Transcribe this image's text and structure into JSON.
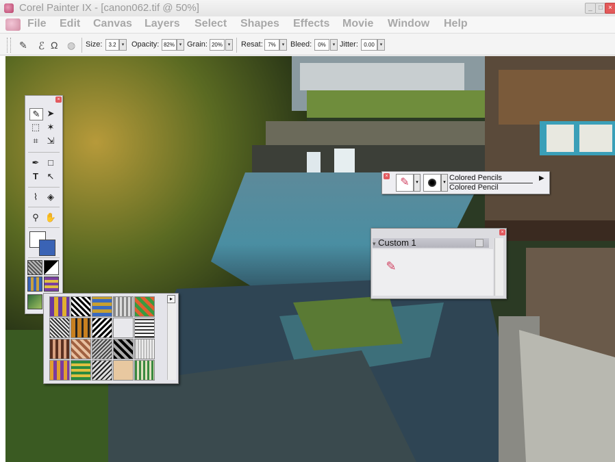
{
  "window": {
    "title": "Corel Painter IX - [canon062.tif @ 50%]"
  },
  "menu": [
    "File",
    "Edit",
    "Canvas",
    "Layers",
    "Select",
    "Shapes",
    "Effects",
    "Movie",
    "Window",
    "Help"
  ],
  "property_bar": {
    "size_label": "Size:",
    "size_value": "3.2",
    "opacity_label": "Opacity:",
    "opacity_value": "82%",
    "grain_label": "Grain:",
    "grain_value": "20%",
    "resat_label": "Resat:",
    "resat_value": "7%",
    "bleed_label": "Bleed:",
    "bleed_value": "0%",
    "jitter_label": "Jitter:",
    "jitter_value": "0.00"
  },
  "brush_selector": {
    "category": "Colored Pencils",
    "variant": "Colored Pencil"
  },
  "custom_palette": {
    "title": "Custom 1"
  },
  "colors": {
    "main_color": "#ffffff",
    "additional_color": "#3a63b5"
  }
}
